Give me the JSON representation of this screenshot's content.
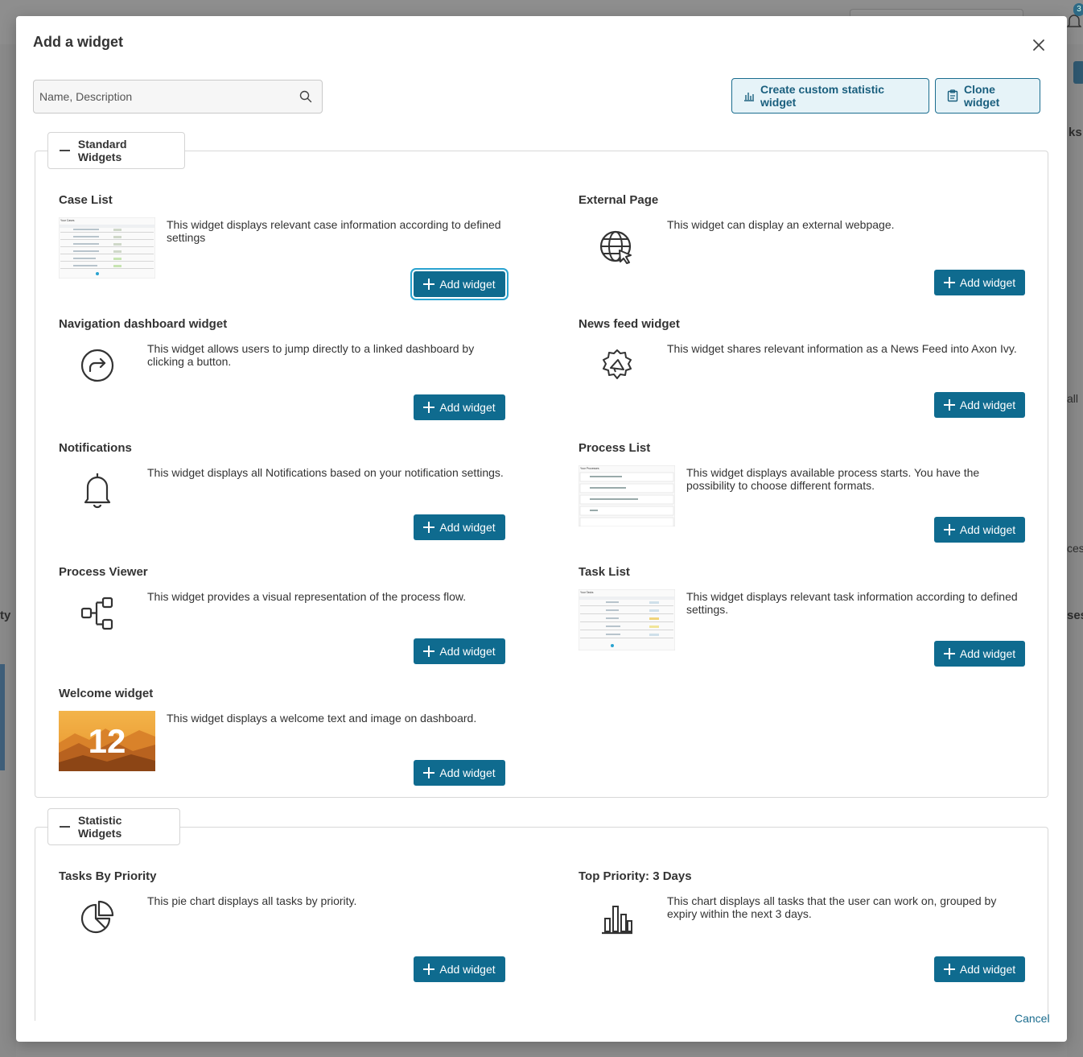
{
  "backdrop": {
    "notification_count": "3",
    "fragments": {
      "left_ty": "ty",
      "right_ks": "ks",
      "right_all": "all",
      "right_ces": "ces",
      "right_ses": "ses"
    }
  },
  "dialog": {
    "title": "Add a widget",
    "search": {
      "placeholder": "Name, Description",
      "value": ""
    },
    "buttons": {
      "create_custom": "Create custom statistic widget",
      "clone": "Clone widget",
      "cancel": "Cancel"
    },
    "add_label": "Add widget"
  },
  "standard": {
    "title": "Standard Widgets",
    "widgets": [
      {
        "name": "Case List",
        "description": "This widget displays relevant case information according to defined settings",
        "preview": "case-list-preview"
      },
      {
        "name": "External Page",
        "description": "This widget can display an external webpage.",
        "icon": "globe-cursor-icon"
      },
      {
        "name": "Navigation dashboard widget",
        "description": "This widget allows users to jump directly to a linked dashboard by clicking a button.",
        "icon": "circle-arrow-icon"
      },
      {
        "name": "News feed widget",
        "description": "This widget shares relevant information as a News Feed into Axon Ivy.",
        "icon": "megaphone-icon"
      },
      {
        "name": "Notifications",
        "description": "This widget displays all Notifications based on your notification settings.",
        "icon": "bell-icon"
      },
      {
        "name": "Process List",
        "description": "This widget displays available process starts. You have the possibility to choose different formats.",
        "preview": "process-list-preview"
      },
      {
        "name": "Process Viewer",
        "description": "This widget provides a visual representation of the process flow.",
        "icon": "flowchart-icon"
      },
      {
        "name": "Task List",
        "description": "This widget displays relevant task information according to defined settings.",
        "preview": "task-list-preview"
      },
      {
        "name": "Welcome widget",
        "description": "This widget displays a welcome text and image on dashboard.",
        "preview": "welcome-image",
        "preview_text": "12"
      }
    ]
  },
  "statistic": {
    "title": "Statistic Widgets",
    "widgets": [
      {
        "name": "Tasks By Priority",
        "description": "This pie chart displays all tasks by priority.",
        "icon": "pie-chart-icon"
      },
      {
        "name": "Top Priority: 3 Days",
        "description": "This chart displays all tasks that the user can work on, grouped by expiry within the next 3 days.",
        "icon": "bar-chart-icon"
      }
    ]
  },
  "previews": {
    "case_list_heading": "Your Cases",
    "process_list_heading": "Your Processes",
    "task_list_heading": "Your Tasks"
  },
  "colors": {
    "primary": "#0f6b8f",
    "primary_light": "#e6f3f8",
    "focus_ring": "#29a3d0"
  }
}
